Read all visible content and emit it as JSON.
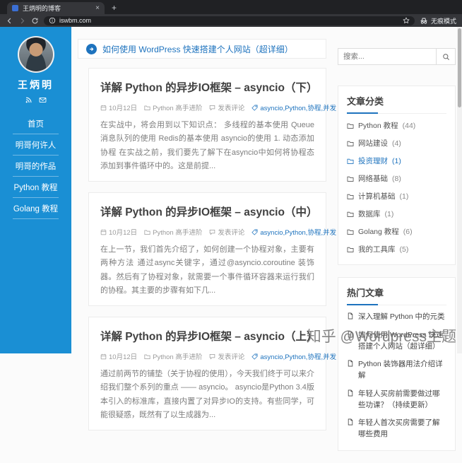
{
  "browser": {
    "tab_title": "王炳明的博客",
    "close_tab": "×",
    "new_tab": "+",
    "url": "iswbm.com",
    "incognito_label": "无痕模式"
  },
  "blog": {
    "name": "王炳明",
    "menu": [
      {
        "label": "首页"
      },
      {
        "label": "明哥何许人"
      },
      {
        "label": "明哥的作品"
      },
      {
        "label": "Python 教程"
      },
      {
        "label": "Golang 教程"
      }
    ]
  },
  "announcement": {
    "text": "如何使用 WordPress 快速搭建个人网站（超详细）"
  },
  "posts": [
    {
      "title": "详解 Python 的异步IO框架 – asyncio（下）",
      "date": "10月12日",
      "category": "Python 高手进阶",
      "comments": "发表评论",
      "tags": "asyncio,Python,协程,并发",
      "excerpt": "在实战中，将会用到以下知识点： 多线程的基本使用 Queue消息队列的使用 Redis的基本使用 asyncio的使用 1. 动态添加协程 在实战之前，我们要先了解下在asyncio中如何将协程态添加到事件循环中的。这是前提..."
    },
    {
      "title": "详解 Python 的异步IO框架 – asyncio（中）",
      "date": "10月12日",
      "category": "Python 高手进阶",
      "comments": "发表评论",
      "tags": "asyncio,Python,协程,并发",
      "excerpt": "在上一节，我们首先介绍了，如何创建一个协程对象，主要有两种方法 通过async关键字，通过@asyncio.coroutine 装饰器。然后有了协程对象，就需要一个事件循环容器来运行我们的协程。其主要的步骤有如下几..."
    },
    {
      "title": "详解 Python 的异步IO框架 – asyncio（上）",
      "date": "10月12日",
      "category": "Python 高手进阶",
      "comments": "发表评论",
      "tags": "asyncio,Python,协程,并发",
      "excerpt": "通过前两节的铺垫（关于协程的使用），今天我们终于可以来介绍我们整个系列的重点 —— asyncio。 asyncio是Python 3.4版本引入的标准库，直接内置了对异步IO的支持。有些同学，可能很疑惑，既然有了以生成器为..."
    }
  ],
  "search": {
    "placeholder": "搜索..."
  },
  "categories": {
    "title": "文章分类",
    "items": [
      {
        "label": "Python 教程",
        "count": "(44)"
      },
      {
        "label": "网站建设",
        "count": "(4)"
      },
      {
        "label": "投资理财",
        "count": "(1)"
      },
      {
        "label": "网络基础",
        "count": "(8)"
      },
      {
        "label": "计算机基础",
        "count": "(1)"
      },
      {
        "label": "数据库",
        "count": "(1)"
      },
      {
        "label": "Golang 教程",
        "count": "(6)"
      },
      {
        "label": "我的工具库",
        "count": "(5)"
      }
    ]
  },
  "hot": {
    "title": "热门文章",
    "items": [
      {
        "label": "深入理解 Python 中的元类"
      },
      {
        "label": "如何使用 WordPress 快速搭建个人网站（超详细）"
      },
      {
        "label": "Python 装饰器用法介绍详解"
      },
      {
        "label": "年轻人买房前需要做过哪些功课？（持续更新）"
      },
      {
        "label": "年轻人首次买房需要了解哪些费用"
      }
    ]
  },
  "watermark": "知乎 @Wordpress主题",
  "colors": {
    "accent": "#1e73be",
    "sidebar": "#1a8fd4"
  }
}
